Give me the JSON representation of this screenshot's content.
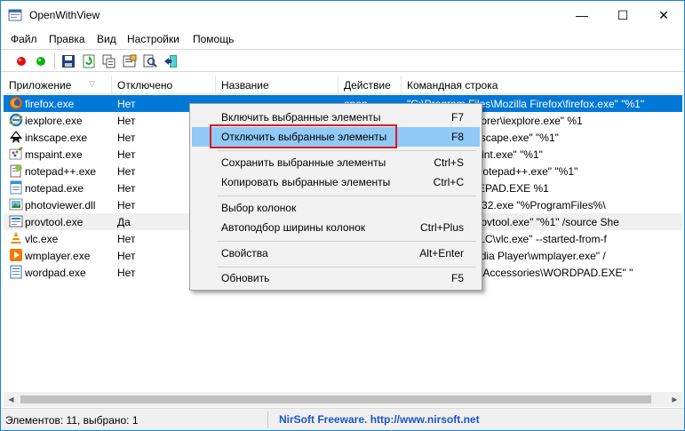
{
  "window": {
    "title": "OpenWithView",
    "min_glyph": "—",
    "max_glyph": "☐",
    "close_glyph": "✕"
  },
  "menu": {
    "file": "Файл",
    "edit": "Правка",
    "view": "Вид",
    "settings": "Настройки",
    "help": "Помощь"
  },
  "columns": {
    "app": "Приложение",
    "disabled": "Отключено",
    "name": "Название",
    "action": "Действие",
    "cmd": "Командная строка"
  },
  "rows": [
    {
      "app": "firefox.exe",
      "disabled": "Нет",
      "action": "open",
      "cmd": "\"C:\\Program Files\\Mozilla Firefox\\firefox.exe\" \"%1\"",
      "selected": true,
      "icon": "firefox-icon"
    },
    {
      "app": "iexplore.exe",
      "disabled": "Нет",
      "action": "",
      "cmd": "es\\Internet Explorer\\iexplore.exe\" %1",
      "icon": "ie-icon"
    },
    {
      "app": "inkscape.exe",
      "disabled": "Нет",
      "action": "",
      "cmd": "es\\Inkscape\\inkscape.exe\" \"%1\"",
      "icon": "inkscape-icon"
    },
    {
      "app": "mspaint.exe",
      "disabled": "Нет",
      "action": "",
      "cmd": "system32\\mspaint.exe\" \"%1\"",
      "icon": "paint-icon"
    },
    {
      "app": "notepad++.exe",
      "disabled": "Нет",
      "action": "",
      "cmd": "es\\Notepad++\\notepad++.exe\" \"%1\"",
      "icon": "notepadpp-icon"
    },
    {
      "app": "notepad.exe",
      "disabled": "Нет",
      "action": "",
      "cmd": "system32\\NOTEPAD.EXE %1",
      "icon": "notepad-icon"
    },
    {
      "app": "photoviewer.dll",
      "disabled": "Нет",
      "action": "",
      "cmd": "system32\\rundll32.exe \"%ProgramFiles%\\",
      "icon": "photoviewer-icon"
    },
    {
      "app": "provtool.exe",
      "disabled": "Да",
      "action": "",
      "cmd": "es\\System32\\provtool.exe\" \"%1\" /source She",
      "icon": "provtool-icon",
      "alt": true
    },
    {
      "app": "vlc.exe",
      "disabled": "Нет",
      "action": "",
      "cmd": "es\\VideoLAN\\VLC\\vlc.exe\" --started-from-f",
      "icon": "vlc-icon"
    },
    {
      "app": "wmplayer.exe",
      "disabled": "Нет",
      "action": "",
      "cmd": "%\\Windows Media Player\\wmplayer.exe\" /",
      "icon": "wmplayer-icon"
    },
    {
      "app": "wordpad.exe",
      "disabled": "Нет",
      "action": "",
      "cmd": "%\\Windows NT\\Accessories\\WORDPAD.EXE\" \"",
      "icon": "wordpad-icon"
    }
  ],
  "context_menu": {
    "enable": {
      "label": "Включить выбранные элементы",
      "key": "F7"
    },
    "disable": {
      "label": "Отключить выбранные элементы",
      "key": "F8"
    },
    "save": {
      "label": "Сохранить выбранные элементы",
      "key": "Ctrl+S"
    },
    "copy": {
      "label": "Копировать выбранные элементы",
      "key": "Ctrl+C"
    },
    "choose_columns": {
      "label": "Выбор колонок",
      "key": ""
    },
    "autosize": {
      "label": "Автоподбор ширины колонок",
      "key": "Ctrl+Plus"
    },
    "properties": {
      "label": "Свойства",
      "key": "Alt+Enter"
    },
    "refresh": {
      "label": "Обновить",
      "key": "F5"
    }
  },
  "status": {
    "items": "Элементов: 11, выбрано: 1",
    "link": "NirSoft Freeware.  http://www.nirsoft.net"
  },
  "colors": {
    "selection": "#0078d7",
    "menu_hover": "#91c9f7",
    "highlight": "#e0191b",
    "link": "#1b55c8"
  }
}
